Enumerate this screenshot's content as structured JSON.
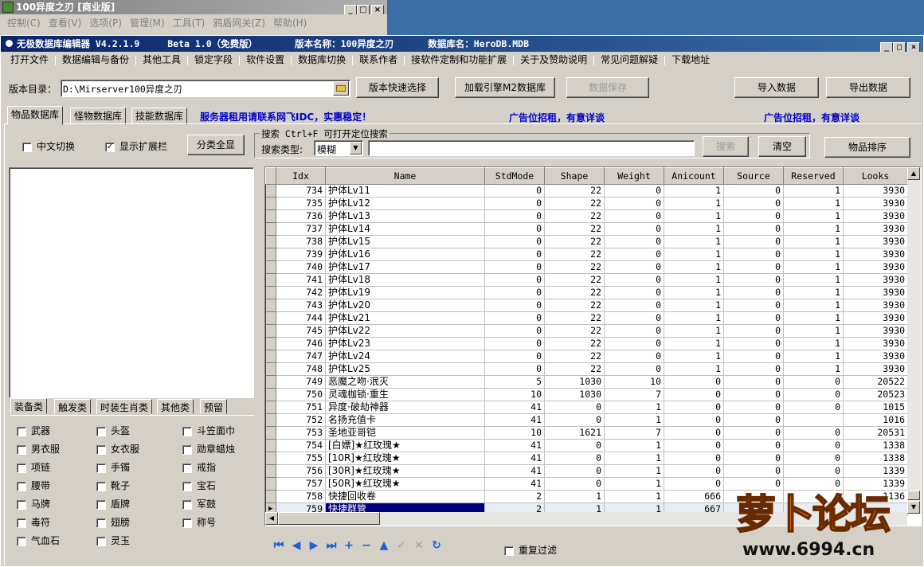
{
  "bg_window": {
    "title": "100异度之刃 [商业版]",
    "menu": [
      "控制(C)",
      "查看(V)",
      "选项(P)",
      "管理(M)",
      "工具(T)",
      "鸦盾网关(Z)",
      "帮助(H)"
    ]
  },
  "main_window": {
    "title_parts": [
      "无极数据库编辑器 V4.2.1.9",
      "Beta 1.0（免费版）",
      "版本名称：100异度之刃",
      "数据库名：HeroDB.MDB"
    ],
    "menu": [
      "打开文件",
      "数据编辑与备份",
      "其他工具",
      "锁定字段",
      "软件设置",
      "数据库切换",
      "联系作者",
      "接软件定制和功能扩展",
      "关于及赞助说明",
      "常见问题解疑",
      "下载地址"
    ]
  },
  "toolbar": {
    "dir_label": "版本目录：",
    "dir_value": "D:\\Mirserver100异度之刃",
    "quick_select": "版本快速选择",
    "load_m2": "加载引擎M2数据库",
    "save_data": "数据保存",
    "import": "导入数据",
    "export": "导出数据"
  },
  "tabs": [
    "物品数据库",
    "怪物数据库",
    "技能数据库"
  ],
  "ads": [
    "服务器租用请联系网飞IDC，实惠稳定！",
    "广告位招租，有意详谈",
    "广告位招租，有意详谈"
  ],
  "options": {
    "chinese_switch": "中文切换",
    "show_ext": "显示扩展栏",
    "show_ext_checked": true,
    "show_all": "分类全显"
  },
  "search": {
    "group_label": "搜索  Ctrl+F 可打开定位搜索",
    "type_label": "搜索类型:",
    "type_value": "模糊",
    "input_value": "",
    "search_btn": "搜索",
    "clear_btn": "清空",
    "sort_btn": "物品排序"
  },
  "category_tabs": [
    "装备类",
    "触发类",
    "时装生肖类",
    "其他类",
    "预留"
  ],
  "category_items": [
    [
      "武器",
      "头盔",
      "斗笠面巾"
    ],
    [
      "男衣服",
      "女衣服",
      "勋章蜡烛"
    ],
    [
      "项链",
      "手镯",
      "戒指"
    ],
    [
      "腰带",
      "靴子",
      "宝石"
    ],
    [
      "马牌",
      "盾牌",
      "军鼓"
    ],
    [
      "毒符",
      "翅膀",
      "称号"
    ],
    [
      "气血石",
      "灵玉",
      ""
    ]
  ],
  "grid": {
    "columns": [
      "Idx",
      "Name",
      "StdMode",
      "Shape",
      "Weight",
      "Anicount",
      "Source",
      "Reserved",
      "Looks"
    ],
    "rows": [
      [
        "734",
        "护体Lv11",
        "0",
        "22",
        "0",
        "1",
        "0",
        "1",
        "3930"
      ],
      [
        "735",
        "护体Lv12",
        "0",
        "22",
        "0",
        "1",
        "0",
        "1",
        "3930"
      ],
      [
        "736",
        "护体Lv13",
        "0",
        "22",
        "0",
        "1",
        "0",
        "1",
        "3930"
      ],
      [
        "737",
        "护体Lv14",
        "0",
        "22",
        "0",
        "1",
        "0",
        "1",
        "3930"
      ],
      [
        "738",
        "护体Lv15",
        "0",
        "22",
        "0",
        "1",
        "0",
        "1",
        "3930"
      ],
      [
        "739",
        "护体Lv16",
        "0",
        "22",
        "0",
        "1",
        "0",
        "1",
        "3930"
      ],
      [
        "740",
        "护体Lv17",
        "0",
        "22",
        "0",
        "1",
        "0",
        "1",
        "3930"
      ],
      [
        "741",
        "护体Lv18",
        "0",
        "22",
        "0",
        "1",
        "0",
        "1",
        "3930"
      ],
      [
        "742",
        "护体Lv19",
        "0",
        "22",
        "0",
        "1",
        "0",
        "1",
        "3930"
      ],
      [
        "743",
        "护体Lv20",
        "0",
        "22",
        "0",
        "1",
        "0",
        "1",
        "3930"
      ],
      [
        "744",
        "护体Lv21",
        "0",
        "22",
        "0",
        "1",
        "0",
        "1",
        "3930"
      ],
      [
        "745",
        "护体Lv22",
        "0",
        "22",
        "0",
        "1",
        "0",
        "1",
        "3930"
      ],
      [
        "746",
        "护体Lv23",
        "0",
        "22",
        "0",
        "1",
        "0",
        "1",
        "3930"
      ],
      [
        "747",
        "护体Lv24",
        "0",
        "22",
        "0",
        "1",
        "0",
        "1",
        "3930"
      ],
      [
        "748",
        "护体Lv25",
        "0",
        "22",
        "0",
        "1",
        "0",
        "1",
        "3930"
      ],
      [
        "749",
        "恶魔之吻·泯灭",
        "5",
        "1030",
        "10",
        "0",
        "0",
        "0",
        "20522"
      ],
      [
        "750",
        "灵魂枷锁·重生",
        "10",
        "1030",
        "7",
        "0",
        "0",
        "0",
        "20523"
      ],
      [
        "751",
        "异度·破劫神器",
        "41",
        "0",
        "1",
        "0",
        "0",
        "0",
        "1015"
      ],
      [
        "752",
        "名扬充值卡",
        "41",
        "0",
        "1",
        "0",
        "0",
        "",
        "1016"
      ],
      [
        "753",
        "圣地亚哥铠",
        "10",
        "1621",
        "7",
        "0",
        "0",
        "0",
        "20531"
      ],
      [
        "754",
        "[白嫖]★红玫瑰★",
        "41",
        "0",
        "1",
        "0",
        "0",
        "0",
        "1338"
      ],
      [
        "755",
        "[10R]★红玫瑰★",
        "41",
        "0",
        "1",
        "0",
        "0",
        "0",
        "1338"
      ],
      [
        "756",
        "[30R]★红玫瑰★",
        "41",
        "0",
        "1",
        "0",
        "0",
        "0",
        "1339"
      ],
      [
        "757",
        "[50R]★红玫瑰★",
        "41",
        "0",
        "1",
        "0",
        "0",
        "0",
        "1339"
      ],
      [
        "758",
        "快捷回收卷",
        "2",
        "1",
        "1",
        "666",
        "",
        "",
        "1136"
      ],
      [
        "759",
        "快捷群管",
        "2",
        "1",
        "1",
        "667",
        "",
        "",
        ""
      ]
    ],
    "selected_index": 25
  },
  "footer": {
    "repeat_filter": "重复过滤"
  },
  "watermark": {
    "title": "萝卜论坛",
    "url": "www.6994.cn"
  }
}
